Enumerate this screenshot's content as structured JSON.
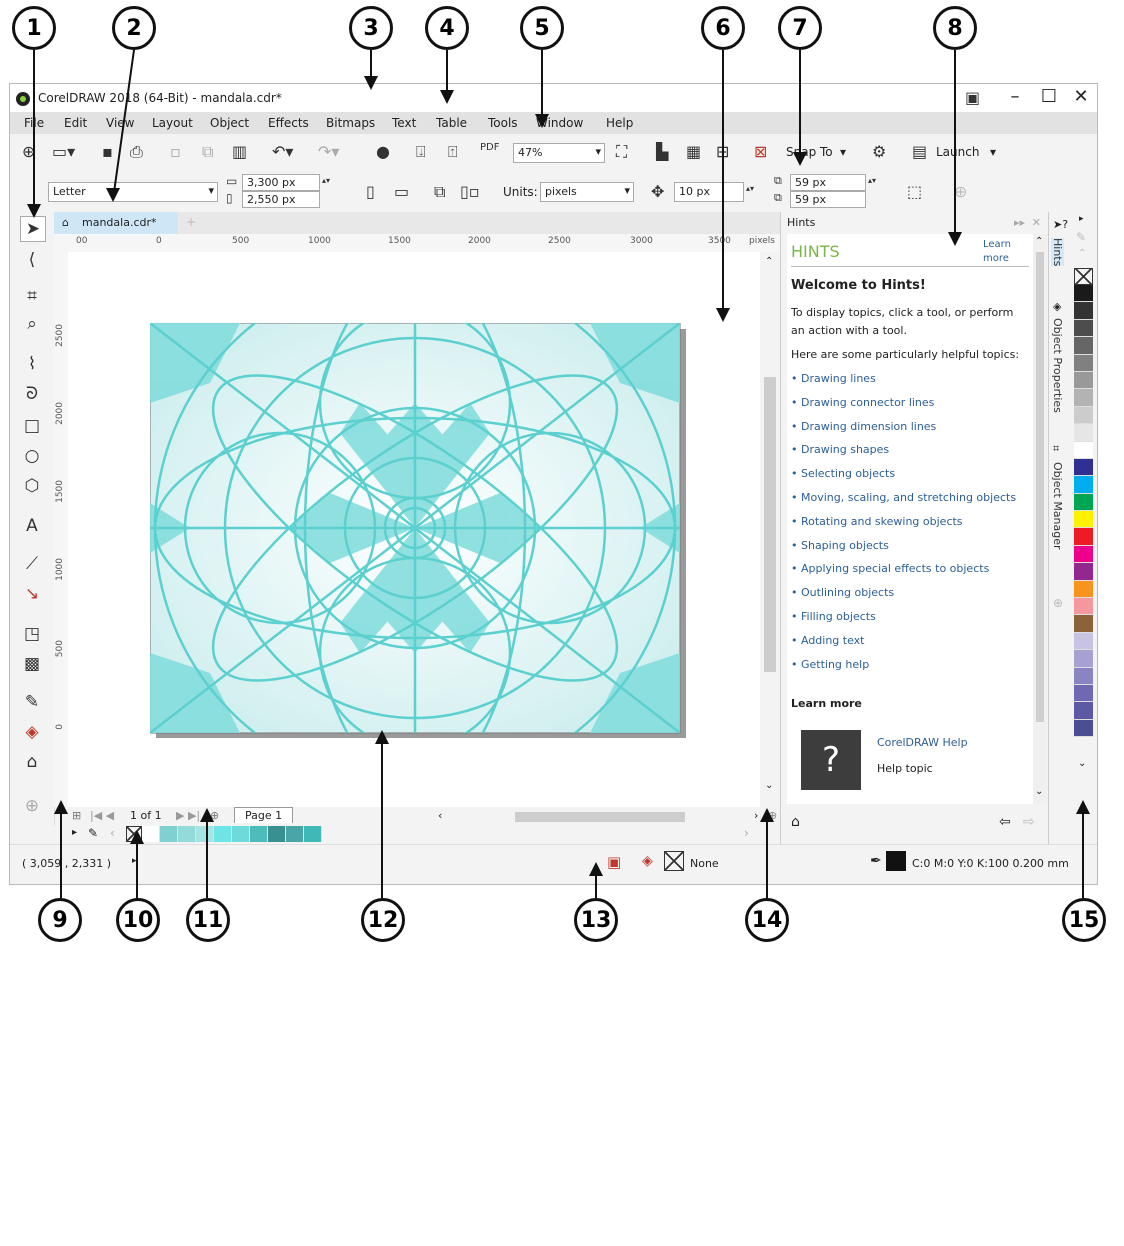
{
  "callouts": [
    "1",
    "2",
    "3",
    "4",
    "5",
    "6",
    "7",
    "8",
    "9",
    "10",
    "11",
    "12",
    "13",
    "14",
    "15"
  ],
  "window": {
    "title": "CorelDRAW 2018 (64-Bit) - mandala.cdr*",
    "controls": [
      "–",
      "☐",
      "✕"
    ]
  },
  "menu": [
    "File",
    "Edit",
    "View",
    "Layout",
    "Object",
    "Effects",
    "Bitmaps",
    "Text",
    "Table",
    "Tools",
    "Window",
    "Help"
  ],
  "toolbar": {
    "zoom_value": "47%",
    "snap_label": "Snap To",
    "launch_label": "Launch"
  },
  "propbar": {
    "page_size": "Letter",
    "width": "3,300 px",
    "height": "2,550 px",
    "units_label": "Units:",
    "units_value": "pixels",
    "nudge": "10 px",
    "dup_x": "59 px",
    "dup_y": "59 px"
  },
  "document_tab": "mandala.cdr*",
  "ruler": {
    "h_ticks": [
      "00",
      "0",
      "500",
      "1000",
      "1500",
      "2000",
      "2500",
      "3000",
      "3500"
    ],
    "h_unit": "pixels",
    "v_ticks": [
      "2500",
      "2000",
      "1500",
      "1000",
      "500",
      "0"
    ]
  },
  "page_nav": {
    "page_of": "1  of  1",
    "page_tab": "Page 1"
  },
  "document_palette": [
    "#ffffff",
    "#7fd0d0",
    "#93dada",
    "#a6e4e4",
    "#6fe4e4",
    "#6fdada",
    "#4fbcbc",
    "#3a8f8f",
    "#4aa6a6",
    "#3fb8b8"
  ],
  "status": {
    "coords": "( 3,059 , 2,331 )",
    "fill_label": "None",
    "outline_info": "C:0 M:0 Y:0 K:100  0.200 mm"
  },
  "hints": {
    "panel_title": "Hints",
    "heading": "HINTS",
    "learn_more_link": "Learn more",
    "welcome": "Welcome to Hints!",
    "intro": "To display topics, click a tool, or perform an action with a tool.",
    "helpful": "Here are some particularly helpful topics:",
    "topics": [
      "• Drawing lines",
      "• Drawing connector lines",
      "• Drawing dimension lines",
      "• Drawing shapes",
      "• Selecting objects",
      "• Moving, scaling, and stretching objects",
      "• Rotating and skewing objects",
      "• Shaping objects",
      "• Applying special effects to objects",
      "• Outlining objects",
      "• Filling objects",
      "• Adding text",
      "• Getting help"
    ],
    "learn_more_heading": "Learn more",
    "help_title": "CorelDRAW Help",
    "help_sub": "Help topic",
    "help_glyph": "?"
  },
  "docker_tabs": [
    "Hints",
    "Object Properties",
    "Object Manager"
  ],
  "color_palette": [
    "#1a1a1a",
    "#333333",
    "#4d4d4d",
    "#666666",
    "#808080",
    "#999999",
    "#b3b3b3",
    "#cccccc",
    "#e6e6e6",
    "#ffffff",
    "#2e3192",
    "#00aeef",
    "#00a651",
    "#fff200",
    "#ed1c24",
    "#ec008c",
    "#92278f",
    "#f7941d",
    "#f5989d",
    "#8c6239",
    "#c8c3e2",
    "#a7a0d2",
    "#8a84c3",
    "#6f68b2",
    "#5c5aa5",
    "#4a4f94"
  ]
}
